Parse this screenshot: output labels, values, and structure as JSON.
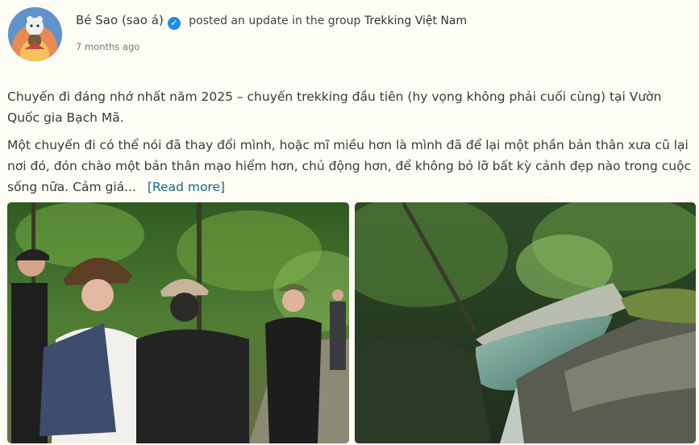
{
  "post": {
    "author_name": "Bé Sao (sao á)",
    "action_text": "posted an update in the group",
    "group_name": "Trekking Việt Nam",
    "timestamp": "7 months ago",
    "paragraph_1": "Chuyến đi đáng nhớ nhất năm 2025 – chuyến trekking đầu tiên (hy vọng không phải cuối cùng) tại Vườn Quốc gia Bạch Mã.",
    "paragraph_2": "Một chuyến đi có thể nói đã thay đổi mình, hoặc mĩ miều hơn là mình đã để lại một phần bản thân xưa cũ lại nơi đó, đón chào một bản thân mạo hiểm hơn, chủ động hơn, để không bỏ lỡ bất kỳ cảnh đẹp nào trong cuộc sống nữa. Cảm giá...",
    "read_more_label": "[Read more]",
    "verified_glyph": "✓"
  },
  "colors": {
    "background": "#fdfcf5",
    "verified_badge": "#1d8fe1",
    "read_more_link": "#17698a"
  },
  "icons": {
    "verified": "verified-badge-icon"
  }
}
